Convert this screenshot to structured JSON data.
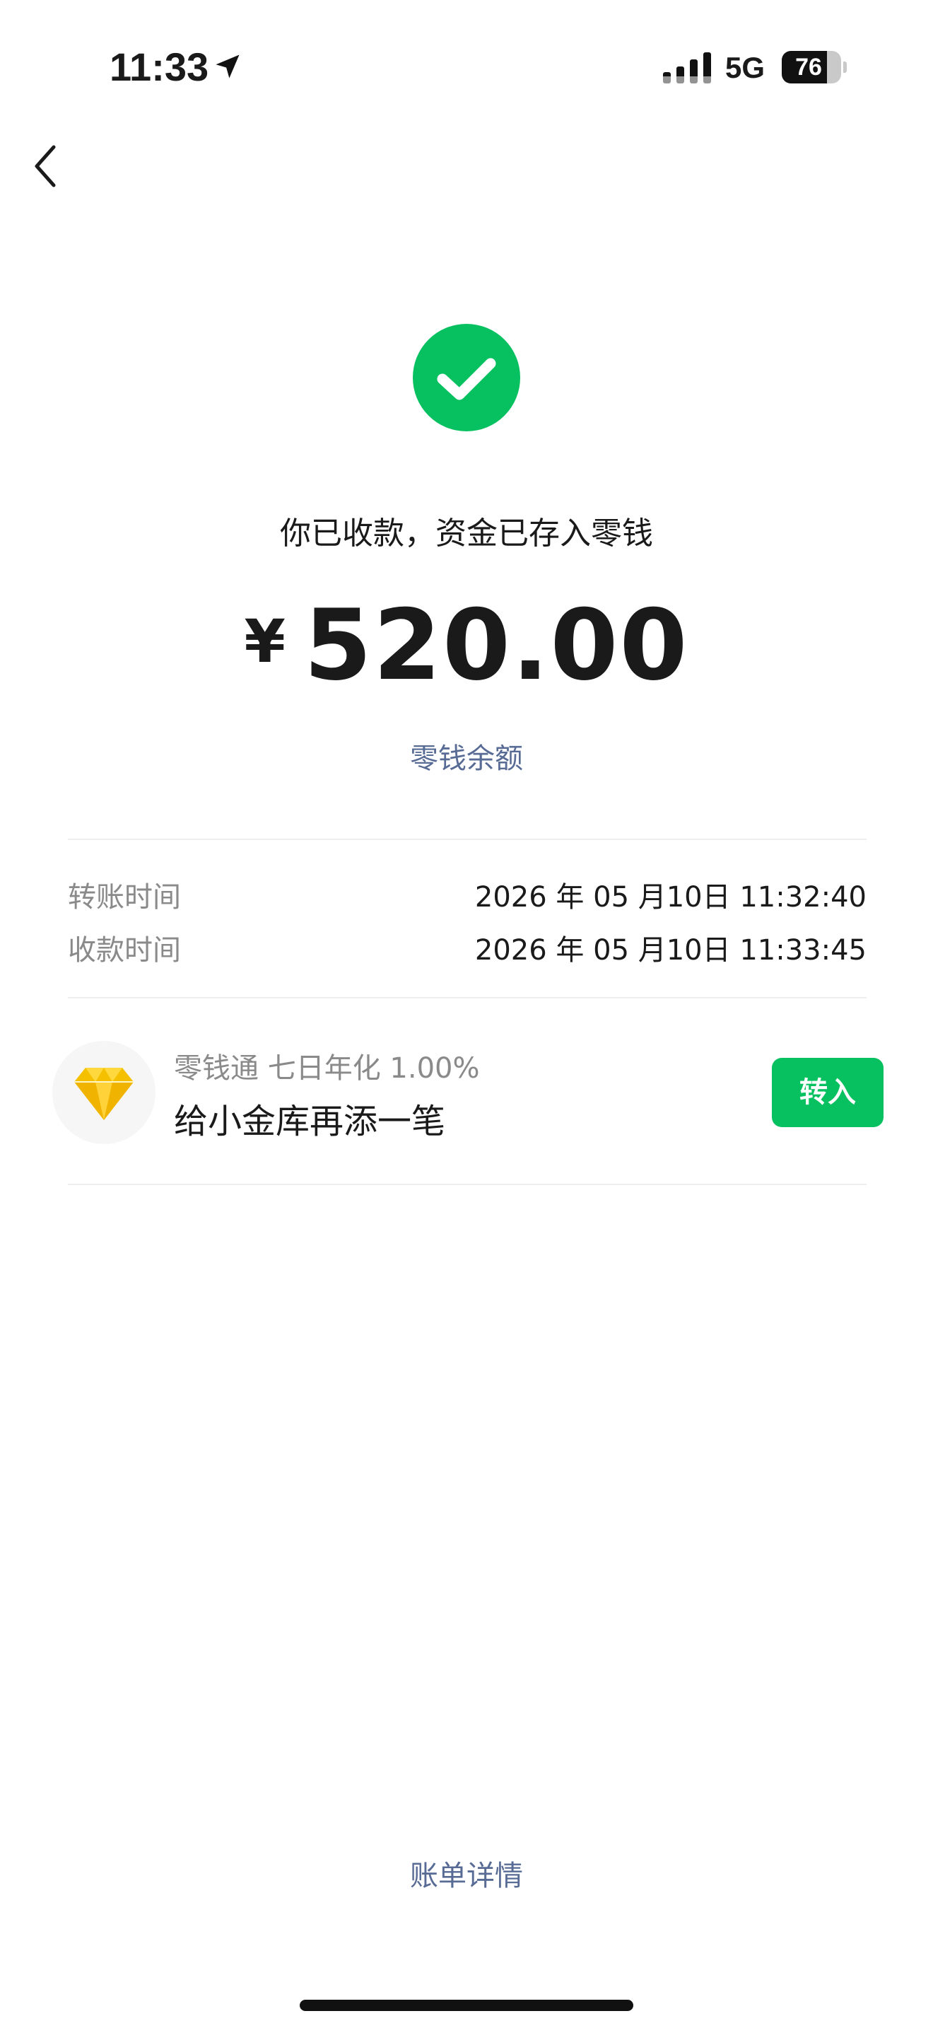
{
  "status_bar": {
    "time": "11:33",
    "network": "5G",
    "battery_level": "76",
    "battery_fraction": 0.76
  },
  "icons": {
    "back": "chevron-left-icon",
    "location": "location-arrow-icon",
    "signal": "cellular-signal-icon",
    "success": "check-circle-icon",
    "product": "diamond-icon"
  },
  "receipt": {
    "headline": "你已收款，资金已存入零钱",
    "currency_symbol": "¥",
    "amount": "520.00",
    "balance_link": "零钱余额"
  },
  "details": [
    {
      "label": "转账时间",
      "value": "2026 年 05 月10日 11:32:40"
    },
    {
      "label": "收款时间",
      "value": "2026 年 05 月10日 11:33:45"
    }
  ],
  "promo": {
    "subtitle": "零钱通 七日年化 1.00%",
    "title": "给小金库再添一笔",
    "button_label": "转入"
  },
  "footer": {
    "bill_link": "账单详情"
  },
  "colors": {
    "accent_green": "#07c160",
    "link_blue": "#576b95",
    "diamond_yellow": "#f5c000"
  }
}
